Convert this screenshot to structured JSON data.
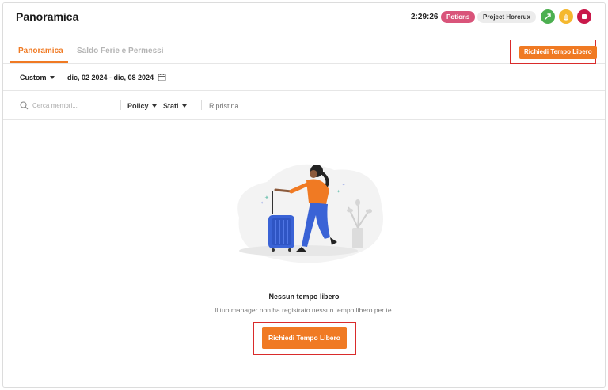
{
  "header": {
    "title": "Panoramica",
    "timer": "2:29:26",
    "project_pill": "Potions",
    "task_pill": "Project Horcrux",
    "colors": {
      "start": "#4caf50",
      "pause": "#f5b82e",
      "stop": "#c9184a"
    }
  },
  "tabs": [
    {
      "label": "Panoramica",
      "active": true
    },
    {
      "label": "Saldo Ferie e Permessi",
      "active": false
    }
  ],
  "actions": {
    "request_button": "Richiedi Tempo Libero"
  },
  "date_filter": {
    "range_mode": "Custom",
    "range": "dic, 02 2024 - dic, 08 2024"
  },
  "filters": {
    "search_placeholder": "Cerca membri...",
    "policy_label": "Policy",
    "status_label": "Stati",
    "reset_label": "Ripristina"
  },
  "empty_state": {
    "title": "Nessun tempo libero",
    "subtitle": "Il tuo manager non ha registrato nessun tempo libero per te.",
    "button": "Richiedi Tempo Libero"
  },
  "accent_color": "#f07a23",
  "highlight_color": "#d92b2b"
}
